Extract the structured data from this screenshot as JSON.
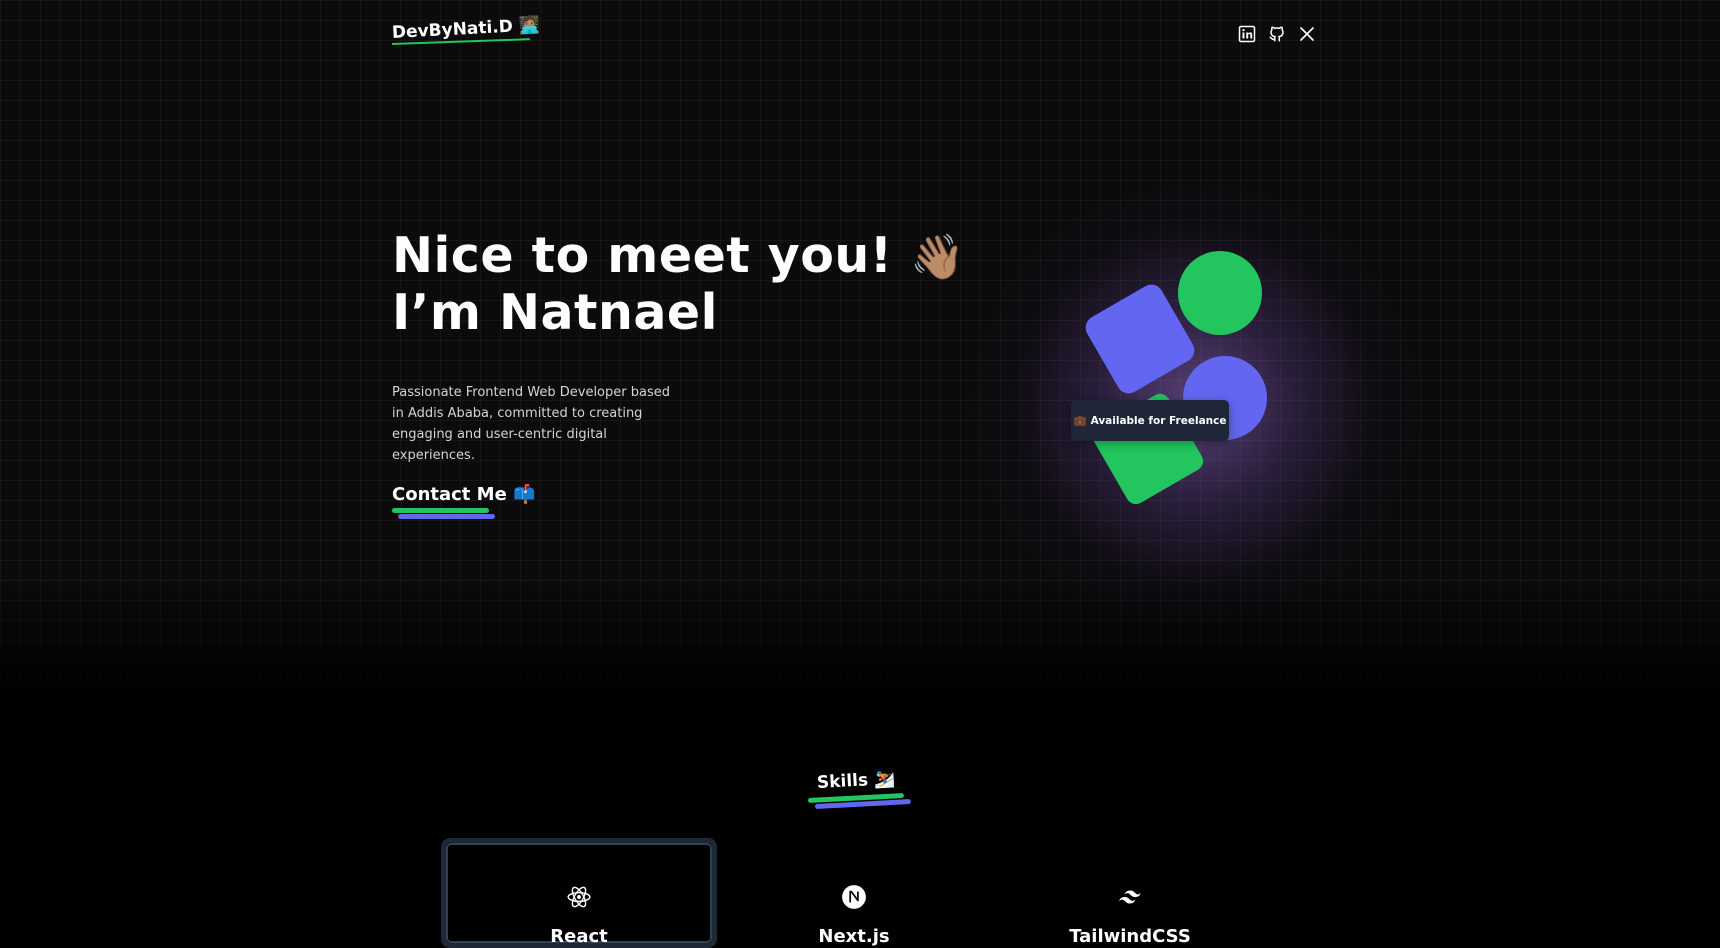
{
  "header": {
    "logo": "DevByNati.D 🧑🏽‍💻",
    "socials": [
      {
        "name": "linkedin-icon"
      },
      {
        "name": "github-icon"
      },
      {
        "name": "x-icon"
      }
    ]
  },
  "hero": {
    "title_line1": "Nice to meet you!",
    "title_emoji": "👋🏽",
    "title_line2": "I’m Natnael",
    "description": "Passionate Frontend Web Developer based in Addis Ababa, committed to creating engaging and user-centric digital experiences.",
    "contact_label": "Contact Me",
    "contact_emoji": "📫",
    "badge_emoji": "💼",
    "badge_label": "Available for Freelance"
  },
  "skills": {
    "title": "Skills",
    "title_emoji": "⛷️",
    "items": [
      {
        "label": "React",
        "icon": "react-icon"
      },
      {
        "label": "Next.js",
        "icon": "nextjs-icon"
      },
      {
        "label": "TailwindCSS",
        "icon": "tailwind-icon"
      }
    ]
  },
  "colors": {
    "accent_green": "#22c55e",
    "accent_blue": "#6366f1",
    "badge_bg": "#1e2638",
    "background": "#000000"
  }
}
